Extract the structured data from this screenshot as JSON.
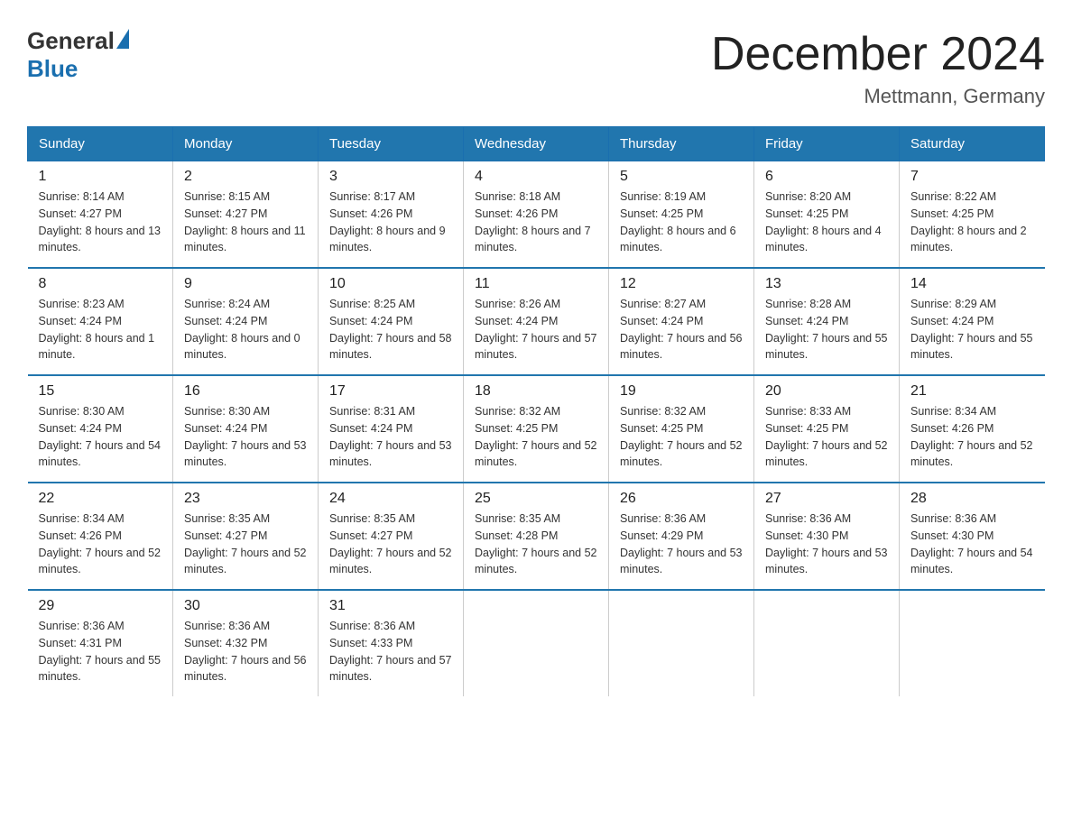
{
  "logo": {
    "text_general": "General",
    "text_blue": "Blue"
  },
  "title": "December 2024",
  "location": "Mettmann, Germany",
  "weekdays": [
    "Sunday",
    "Monday",
    "Tuesday",
    "Wednesday",
    "Thursday",
    "Friday",
    "Saturday"
  ],
  "weeks": [
    [
      {
        "day": "1",
        "sunrise": "8:14 AM",
        "sunset": "4:27 PM",
        "daylight": "8 hours and 13 minutes."
      },
      {
        "day": "2",
        "sunrise": "8:15 AM",
        "sunset": "4:27 PM",
        "daylight": "8 hours and 11 minutes."
      },
      {
        "day": "3",
        "sunrise": "8:17 AM",
        "sunset": "4:26 PM",
        "daylight": "8 hours and 9 minutes."
      },
      {
        "day": "4",
        "sunrise": "8:18 AM",
        "sunset": "4:26 PM",
        "daylight": "8 hours and 7 minutes."
      },
      {
        "day": "5",
        "sunrise": "8:19 AM",
        "sunset": "4:25 PM",
        "daylight": "8 hours and 6 minutes."
      },
      {
        "day": "6",
        "sunrise": "8:20 AM",
        "sunset": "4:25 PM",
        "daylight": "8 hours and 4 minutes."
      },
      {
        "day": "7",
        "sunrise": "8:22 AM",
        "sunset": "4:25 PM",
        "daylight": "8 hours and 2 minutes."
      }
    ],
    [
      {
        "day": "8",
        "sunrise": "8:23 AM",
        "sunset": "4:24 PM",
        "daylight": "8 hours and 1 minute."
      },
      {
        "day": "9",
        "sunrise": "8:24 AM",
        "sunset": "4:24 PM",
        "daylight": "8 hours and 0 minutes."
      },
      {
        "day": "10",
        "sunrise": "8:25 AM",
        "sunset": "4:24 PM",
        "daylight": "7 hours and 58 minutes."
      },
      {
        "day": "11",
        "sunrise": "8:26 AM",
        "sunset": "4:24 PM",
        "daylight": "7 hours and 57 minutes."
      },
      {
        "day": "12",
        "sunrise": "8:27 AM",
        "sunset": "4:24 PM",
        "daylight": "7 hours and 56 minutes."
      },
      {
        "day": "13",
        "sunrise": "8:28 AM",
        "sunset": "4:24 PM",
        "daylight": "7 hours and 55 minutes."
      },
      {
        "day": "14",
        "sunrise": "8:29 AM",
        "sunset": "4:24 PM",
        "daylight": "7 hours and 55 minutes."
      }
    ],
    [
      {
        "day": "15",
        "sunrise": "8:30 AM",
        "sunset": "4:24 PM",
        "daylight": "7 hours and 54 minutes."
      },
      {
        "day": "16",
        "sunrise": "8:30 AM",
        "sunset": "4:24 PM",
        "daylight": "7 hours and 53 minutes."
      },
      {
        "day": "17",
        "sunrise": "8:31 AM",
        "sunset": "4:24 PM",
        "daylight": "7 hours and 53 minutes."
      },
      {
        "day": "18",
        "sunrise": "8:32 AM",
        "sunset": "4:25 PM",
        "daylight": "7 hours and 52 minutes."
      },
      {
        "day": "19",
        "sunrise": "8:32 AM",
        "sunset": "4:25 PM",
        "daylight": "7 hours and 52 minutes."
      },
      {
        "day": "20",
        "sunrise": "8:33 AM",
        "sunset": "4:25 PM",
        "daylight": "7 hours and 52 minutes."
      },
      {
        "day": "21",
        "sunrise": "8:34 AM",
        "sunset": "4:26 PM",
        "daylight": "7 hours and 52 minutes."
      }
    ],
    [
      {
        "day": "22",
        "sunrise": "8:34 AM",
        "sunset": "4:26 PM",
        "daylight": "7 hours and 52 minutes."
      },
      {
        "day": "23",
        "sunrise": "8:35 AM",
        "sunset": "4:27 PM",
        "daylight": "7 hours and 52 minutes."
      },
      {
        "day": "24",
        "sunrise": "8:35 AM",
        "sunset": "4:27 PM",
        "daylight": "7 hours and 52 minutes."
      },
      {
        "day": "25",
        "sunrise": "8:35 AM",
        "sunset": "4:28 PM",
        "daylight": "7 hours and 52 minutes."
      },
      {
        "day": "26",
        "sunrise": "8:36 AM",
        "sunset": "4:29 PM",
        "daylight": "7 hours and 53 minutes."
      },
      {
        "day": "27",
        "sunrise": "8:36 AM",
        "sunset": "4:30 PM",
        "daylight": "7 hours and 53 minutes."
      },
      {
        "day": "28",
        "sunrise": "8:36 AM",
        "sunset": "4:30 PM",
        "daylight": "7 hours and 54 minutes."
      }
    ],
    [
      {
        "day": "29",
        "sunrise": "8:36 AM",
        "sunset": "4:31 PM",
        "daylight": "7 hours and 55 minutes."
      },
      {
        "day": "30",
        "sunrise": "8:36 AM",
        "sunset": "4:32 PM",
        "daylight": "7 hours and 56 minutes."
      },
      {
        "day": "31",
        "sunrise": "8:36 AM",
        "sunset": "4:33 PM",
        "daylight": "7 hours and 57 minutes."
      },
      null,
      null,
      null,
      null
    ]
  ],
  "labels": {
    "sunrise": "Sunrise:",
    "sunset": "Sunset:",
    "daylight": "Daylight:"
  }
}
